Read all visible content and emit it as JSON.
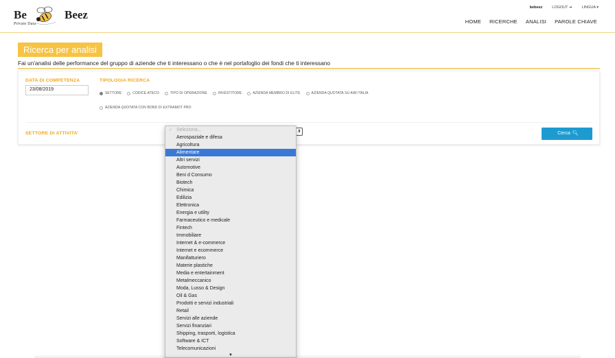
{
  "logo": {
    "word1": "Be",
    "word2": "Beez",
    "tagline": "Private Data"
  },
  "top_links": {
    "user": "bebeez",
    "logout": "LOGOUT ➔",
    "language": "LINGUA ▾"
  },
  "nav": [
    "HOME",
    "RICERCHE",
    "ANALISI",
    "PAROLE CHIAVE"
  ],
  "page": {
    "title": "Ricerca per analisi",
    "subtitle": "Fai un'analisi delle performance del gruppo di aziende che ti interessano o che è nel portafoglio dei fondi che ti interessano"
  },
  "form": {
    "date_label": "DATA DI COMPETENZA",
    "date_value": "23/08/2019",
    "tipologia_label": "TIPOLOGIA RICERCA",
    "radios": [
      {
        "label": "SETTORE",
        "checked": true
      },
      {
        "label": "CODICE ATECO",
        "checked": false
      },
      {
        "label": "TIPO DI OPERAZIONE",
        "checked": false
      },
      {
        "label": "INVESTITORE",
        "checked": false
      },
      {
        "label": "AZIENDA MEMBRO DI ELITE",
        "checked": false
      },
      {
        "label": "AZIENDA QUOTATA SU AIM ITALIA",
        "checked": false
      },
      {
        "label": "AZIENDA QUOTATA CON BOND DI EXTRAMOT PRO",
        "checked": false
      }
    ],
    "settore_label": "SETTORE DI ATTIVITA'",
    "search_button": "Cerca"
  },
  "dropdown": {
    "placeholder": "Seleziona...",
    "selected": "Alimentare",
    "options": [
      "Aerospaziale e difesa",
      "Agricoltura",
      "Alimentare",
      "Altri servizi",
      "Automotive",
      "Beni d Consumo",
      "Biotech",
      "Chimica",
      "Edilizia",
      "Elettronica",
      "Energia e utility",
      "Farmaceutico e medicale",
      "Fintech",
      "Immobiliare",
      "Internet & e-commerce",
      "Internet e ecommerce",
      "Manifatturiero",
      "Materie plastiche",
      "Media e entertainment",
      "Metalmeccanico",
      "Moda, Lusso & Design",
      "Oil & Gas",
      "Prodotti e servizi industriali",
      "Retail",
      "Servizi alle aziende",
      "Servizi finanziari",
      "Shipping, trasporti, logistica",
      "Software & ICT",
      "Telecomunicazioni"
    ]
  },
  "colors": {
    "accent": "#f6c344",
    "label_orange": "#f2a516",
    "button_blue": "#1d9bd1",
    "selection_blue": "#3a78d6"
  }
}
